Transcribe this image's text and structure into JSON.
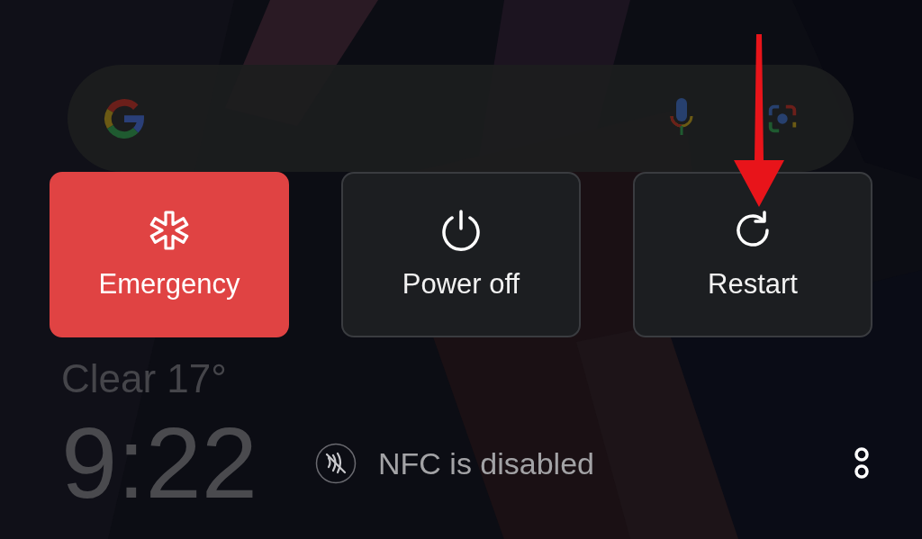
{
  "search_bar": {
    "kind": "search"
  },
  "actions": [
    {
      "kind": "emergency",
      "label": "Emergency"
    },
    {
      "kind": "power",
      "label": "Power off"
    },
    {
      "kind": "restart",
      "label": "Restart"
    }
  ],
  "weather": "Clear 17°",
  "clock": "9:22",
  "nfc_status": "NFC is disabled"
}
